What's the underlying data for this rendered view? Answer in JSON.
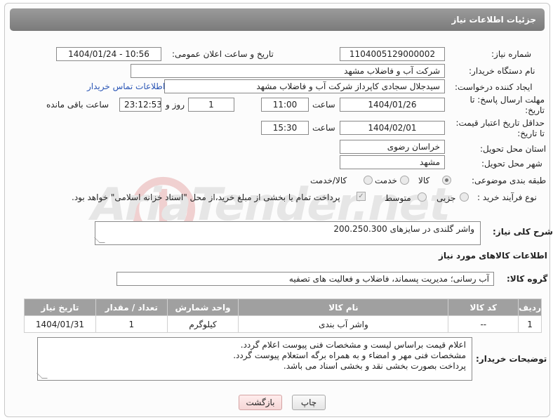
{
  "header": {
    "title": "جزئیات اطلاعات نیاز"
  },
  "fields": {
    "need_number": {
      "label": "شماره نیاز:",
      "value": "1104005129000002"
    },
    "announce": {
      "label": "تاریخ و ساعت اعلان عمومی:",
      "value": "1404/01/24 - 10:56"
    },
    "buyer_org": {
      "label": "نام دستگاه خریدار:",
      "value": "شرکت آب و فاضلاب مشهد"
    },
    "requester": {
      "label": "ایجاد کننده درخواست:",
      "value": "سیدجلال سجادی کاپرداز شرکت آب و فاضلاب مشهد",
      "contact_link": "اطلاعات تماس خریدار"
    },
    "deadline": {
      "label": "مهلت ارسال پاسخ: تا تاریخ:",
      "date": "1404/01/26",
      "time_label": "ساعت",
      "time": "11:00",
      "days": "1",
      "days_label": "روز و",
      "remaining": "23:12:53",
      "remaining_label": "ساعت باقی مانده"
    },
    "validity": {
      "label": "حداقل تاریخ اعتبار قیمت: تا تاریخ:",
      "date": "1404/02/01",
      "time_label": "ساعت",
      "time": "15:30"
    },
    "province": {
      "label": "استان محل تحویل:",
      "value": "خراسان رضوی"
    },
    "city": {
      "label": "شهر محل تحویل:",
      "value": "مشهد"
    },
    "category": {
      "label": "طبقه بندی موضوعی:",
      "options": [
        "کالا",
        "خدمت",
        "کالا/خدمت"
      ],
      "selected": "کالا"
    },
    "process": {
      "label": "نوع فرآیند خرید :",
      "options": [
        "جزیی",
        "متوسط"
      ],
      "payment_note": "پرداخت تمام یا بخشی از مبلغ خرید،از محل \"اسناد خزانه اسلامی\" خواهد بود."
    }
  },
  "description": {
    "label": "شرح کلی نیاز:",
    "value": "واشر گلندی در سایزهای 200.250.300"
  },
  "goods_section": {
    "title": "اطلاعات کالاهای مورد نیاز"
  },
  "goods_group": {
    "label": "گروه کالا:",
    "value": "آب رسانی؛ مدیریت پسماند، فاضلاب و فعالیت های تصفیه"
  },
  "table": {
    "headers": [
      "ردیف",
      "کد کالا",
      "نام کالا",
      "واحد شمارش",
      "تعداد / مقدار",
      "تاریخ نیاز"
    ],
    "rows": [
      [
        "1",
        "--",
        "واشر آب بندی",
        "کیلوگرم",
        "1",
        "1404/01/31"
      ]
    ]
  },
  "buyer_notes": {
    "label": "توضیحات خریدار:",
    "lines": [
      "اعلام قیمت براساس لیست و مشخصات فنی پیوست اعلام گردد.",
      "مشخصات فنی مهر و امضاء و به همراه برگه استعلام پیوست گردد.",
      "پرداخت بصورت بخشی نقد و بخشی اسناد می باشد."
    ]
  },
  "buttons": {
    "print": "چاپ",
    "back": "بازگشت"
  },
  "watermark": {
    "text": "AriaTender.net"
  }
}
